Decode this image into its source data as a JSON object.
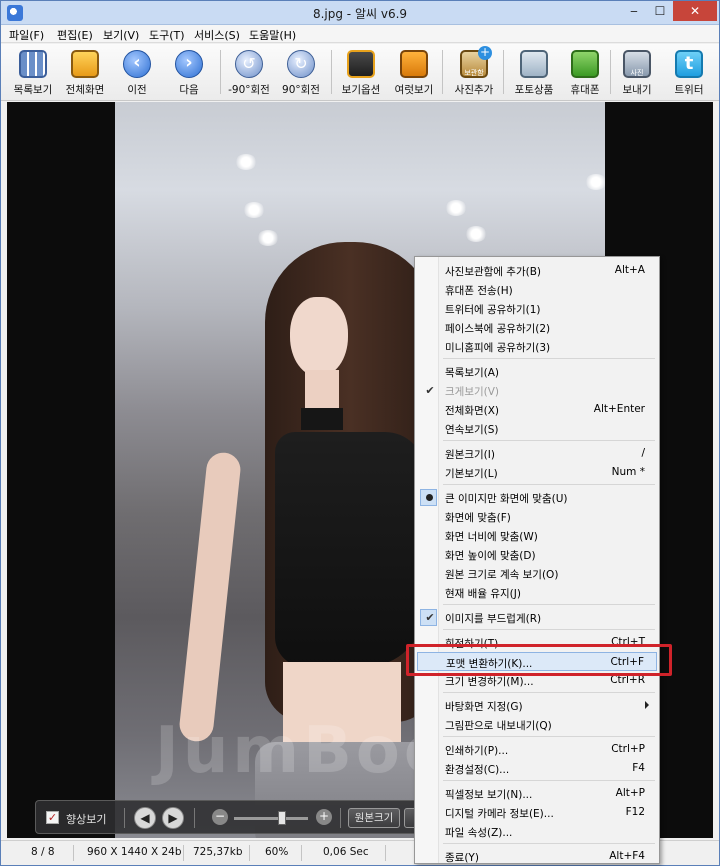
{
  "window": {
    "title": "8.jpg - 알씨 v6.9"
  },
  "menu": [
    "파일(F)",
    "편집(E)",
    "보기(V)",
    "도구(T)",
    "서비스(S)",
    "도움말(H)"
  ],
  "toolbar": {
    "items": [
      "목록보기",
      "전체화면",
      "이전",
      "다음",
      "-90°회전",
      "90°회전",
      "보기옵션",
      "여럿보기",
      "사진추가",
      "포토상품",
      "휴대폰",
      "보내기",
      "트위터"
    ],
    "add_badge": "보관함",
    "send_badge": "사진"
  },
  "viewer": {
    "watermark": "JumBoo",
    "navbar": {
      "label": "향상보기",
      "checked": "✓",
      "fit_button": "원본크기"
    }
  },
  "context_menu": {
    "groups": [
      [
        {
          "label": "사진보관함에 추가(B)",
          "shortcut": "Alt+A"
        },
        {
          "label": "휴대폰 전송(H)",
          "shortcut": ""
        },
        {
          "label": "트위터에 공유하기(1)",
          "shortcut": ""
        },
        {
          "label": "페이스북에 공유하기(2)",
          "shortcut": ""
        },
        {
          "label": "미니홈피에 공유하기(3)",
          "shortcut": ""
        }
      ],
      [
        {
          "label": "목록보기(A)",
          "shortcut": ""
        },
        {
          "label": "크게보기(V)",
          "shortcut": ""
        },
        {
          "label": "전체화면(X)",
          "shortcut": "Alt+Enter"
        },
        {
          "label": "연속보기(S)",
          "shortcut": ""
        }
      ],
      [
        {
          "label": "원본크기(I)",
          "shortcut": "/"
        },
        {
          "label": "기본보기(L)",
          "shortcut": "Num *"
        }
      ],
      [
        {
          "label": "큰 이미지만 화면에 맞춤(U)",
          "shortcut": ""
        },
        {
          "label": "화면에 맞춤(F)",
          "shortcut": ""
        },
        {
          "label": "화면 너비에 맞춤(W)",
          "shortcut": ""
        },
        {
          "label": "화면 높이에 맞춤(D)",
          "shortcut": ""
        },
        {
          "label": "원본 크기로 계속 보기(O)",
          "shortcut": ""
        },
        {
          "label": "현재 배율 유지(J)",
          "shortcut": ""
        }
      ],
      [
        {
          "label": "이미지를 부드럽게(R)",
          "shortcut": ""
        }
      ],
      [
        {
          "label": "회전하기(T)",
          "shortcut": "Ctrl+T"
        },
        {
          "label": "포맷 변환하기(K)...",
          "shortcut": "Ctrl+F"
        },
        {
          "label": "크기 변경하기(M)...",
          "shortcut": "Ctrl+R"
        }
      ],
      [
        {
          "label": "바탕화면 지정(G)",
          "shortcut": ""
        },
        {
          "label": "그림판으로 내보내기(Q)",
          "shortcut": ""
        }
      ],
      [
        {
          "label": "인쇄하기(P)...",
          "shortcut": "Ctrl+P"
        },
        {
          "label": "환경설정(C)...",
          "shortcut": "F4"
        }
      ],
      [
        {
          "label": "픽셀정보 보기(N)...",
          "shortcut": "Alt+P"
        },
        {
          "label": "디지털 카메라 정보(E)...",
          "shortcut": "F12"
        },
        {
          "label": "파일 속성(Z)...",
          "shortcut": ""
        }
      ],
      [
        {
          "label": "종료(Y)",
          "shortcut": "Alt+F4"
        }
      ]
    ],
    "highlighted": "포맷 변환하기(K)...",
    "checked_items": [
      "크게보기(V)",
      "이미지를 부드럽게(R)"
    ],
    "selected_radio": "큰 이미지만 화면에 맞춤(U)",
    "disabled_items": [
      "크게보기(V)"
    ],
    "submenu_items": [
      "바탕화면 지정(G)"
    ]
  },
  "status": {
    "index": "8 / 8",
    "dimensions": "960 X 1440 X 24b",
    "filesize": "725,37kb",
    "zoom": "60%",
    "time": "0,06 Sec"
  },
  "colors": {
    "highlight_box": "#d0232a",
    "menu_highlight": "#dce9f8"
  }
}
